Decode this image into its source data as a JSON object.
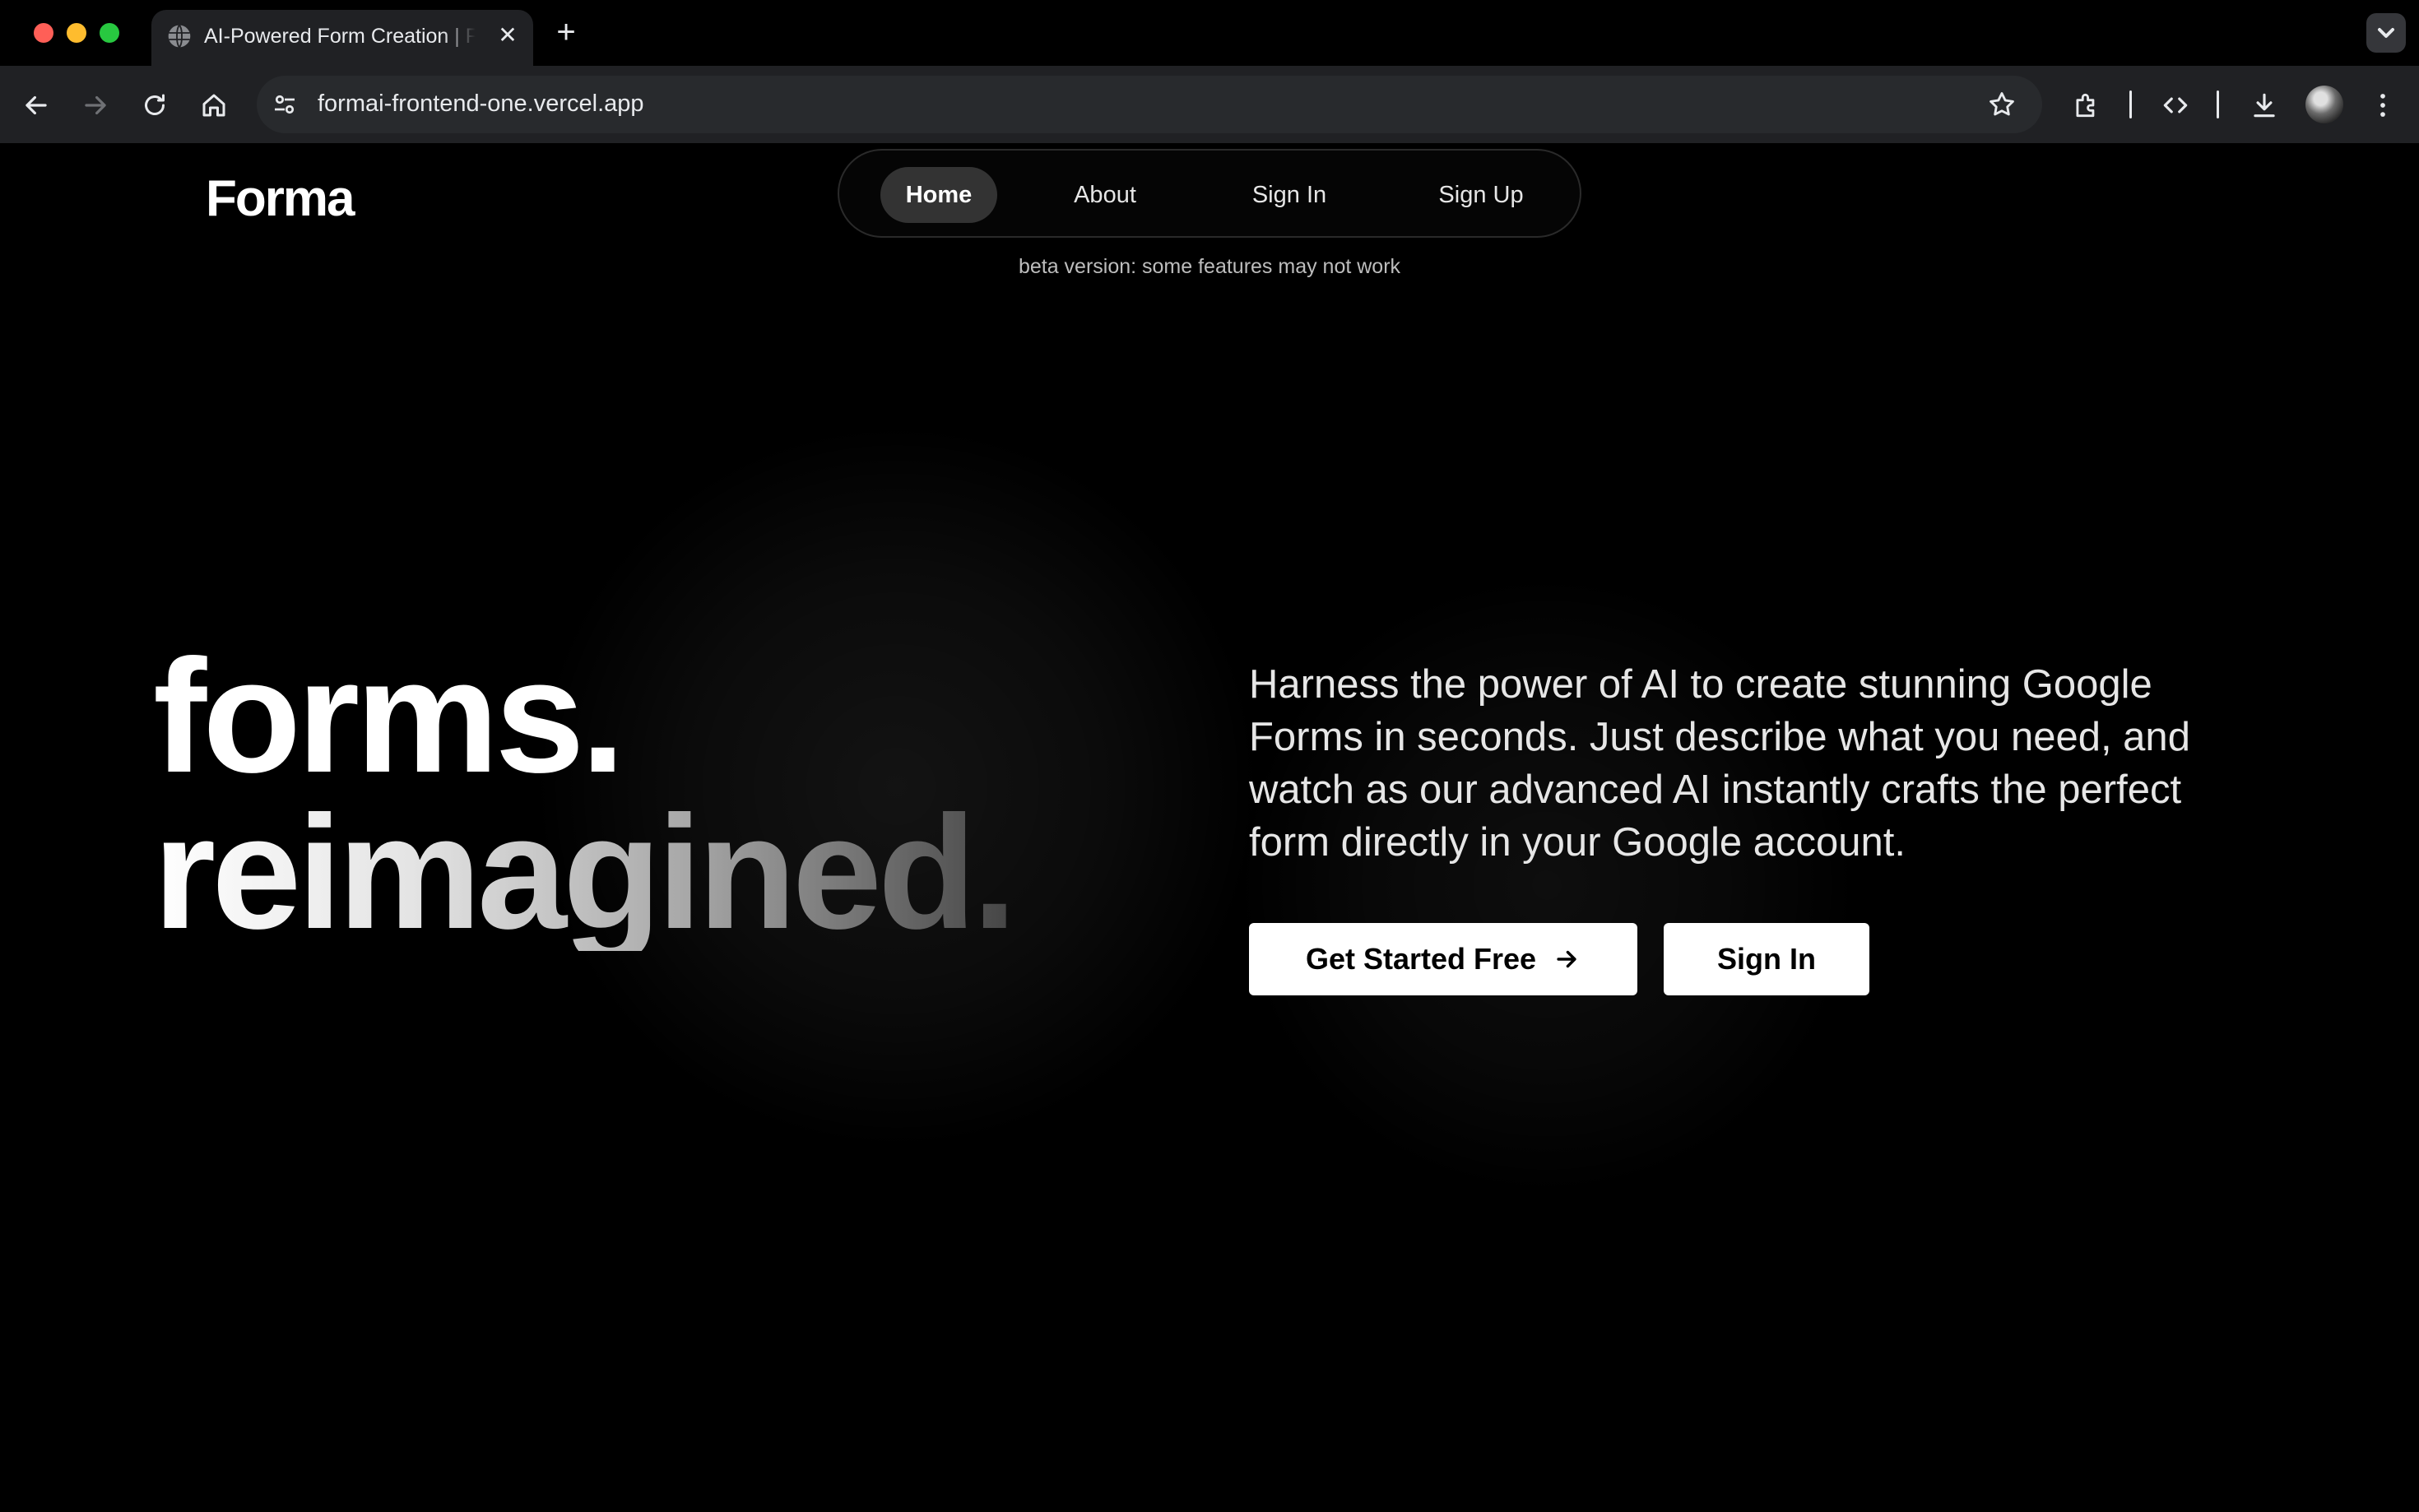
{
  "browser": {
    "tab_title": "AI-Powered Form Creation | Forma",
    "url": "formai-frontend-one.vercel.app",
    "new_tab_symbol": "+",
    "close_symbol": "✕"
  },
  "site": {
    "logo": "Forma",
    "nav": [
      {
        "label": "Home",
        "active": true
      },
      {
        "label": "About",
        "active": false
      },
      {
        "label": "Sign In",
        "active": false
      },
      {
        "label": "Sign Up",
        "active": false
      }
    ],
    "beta_notice": "beta version: some features may not work"
  },
  "hero": {
    "headline_line1": "forms.",
    "headline_line2": "reimagined.",
    "description": "Harness the power of AI to create stunning Google Forms in seconds. Just describe what you need, and watch as our advanced AI instantly crafts the perfect form directly in your Google account.",
    "primary_cta": "Get Started Free",
    "secondary_cta": "Sign In"
  },
  "colors": {
    "background": "#000000",
    "nav_active": "#333333",
    "button_bg": "#ffffff",
    "button_text": "#000000"
  }
}
